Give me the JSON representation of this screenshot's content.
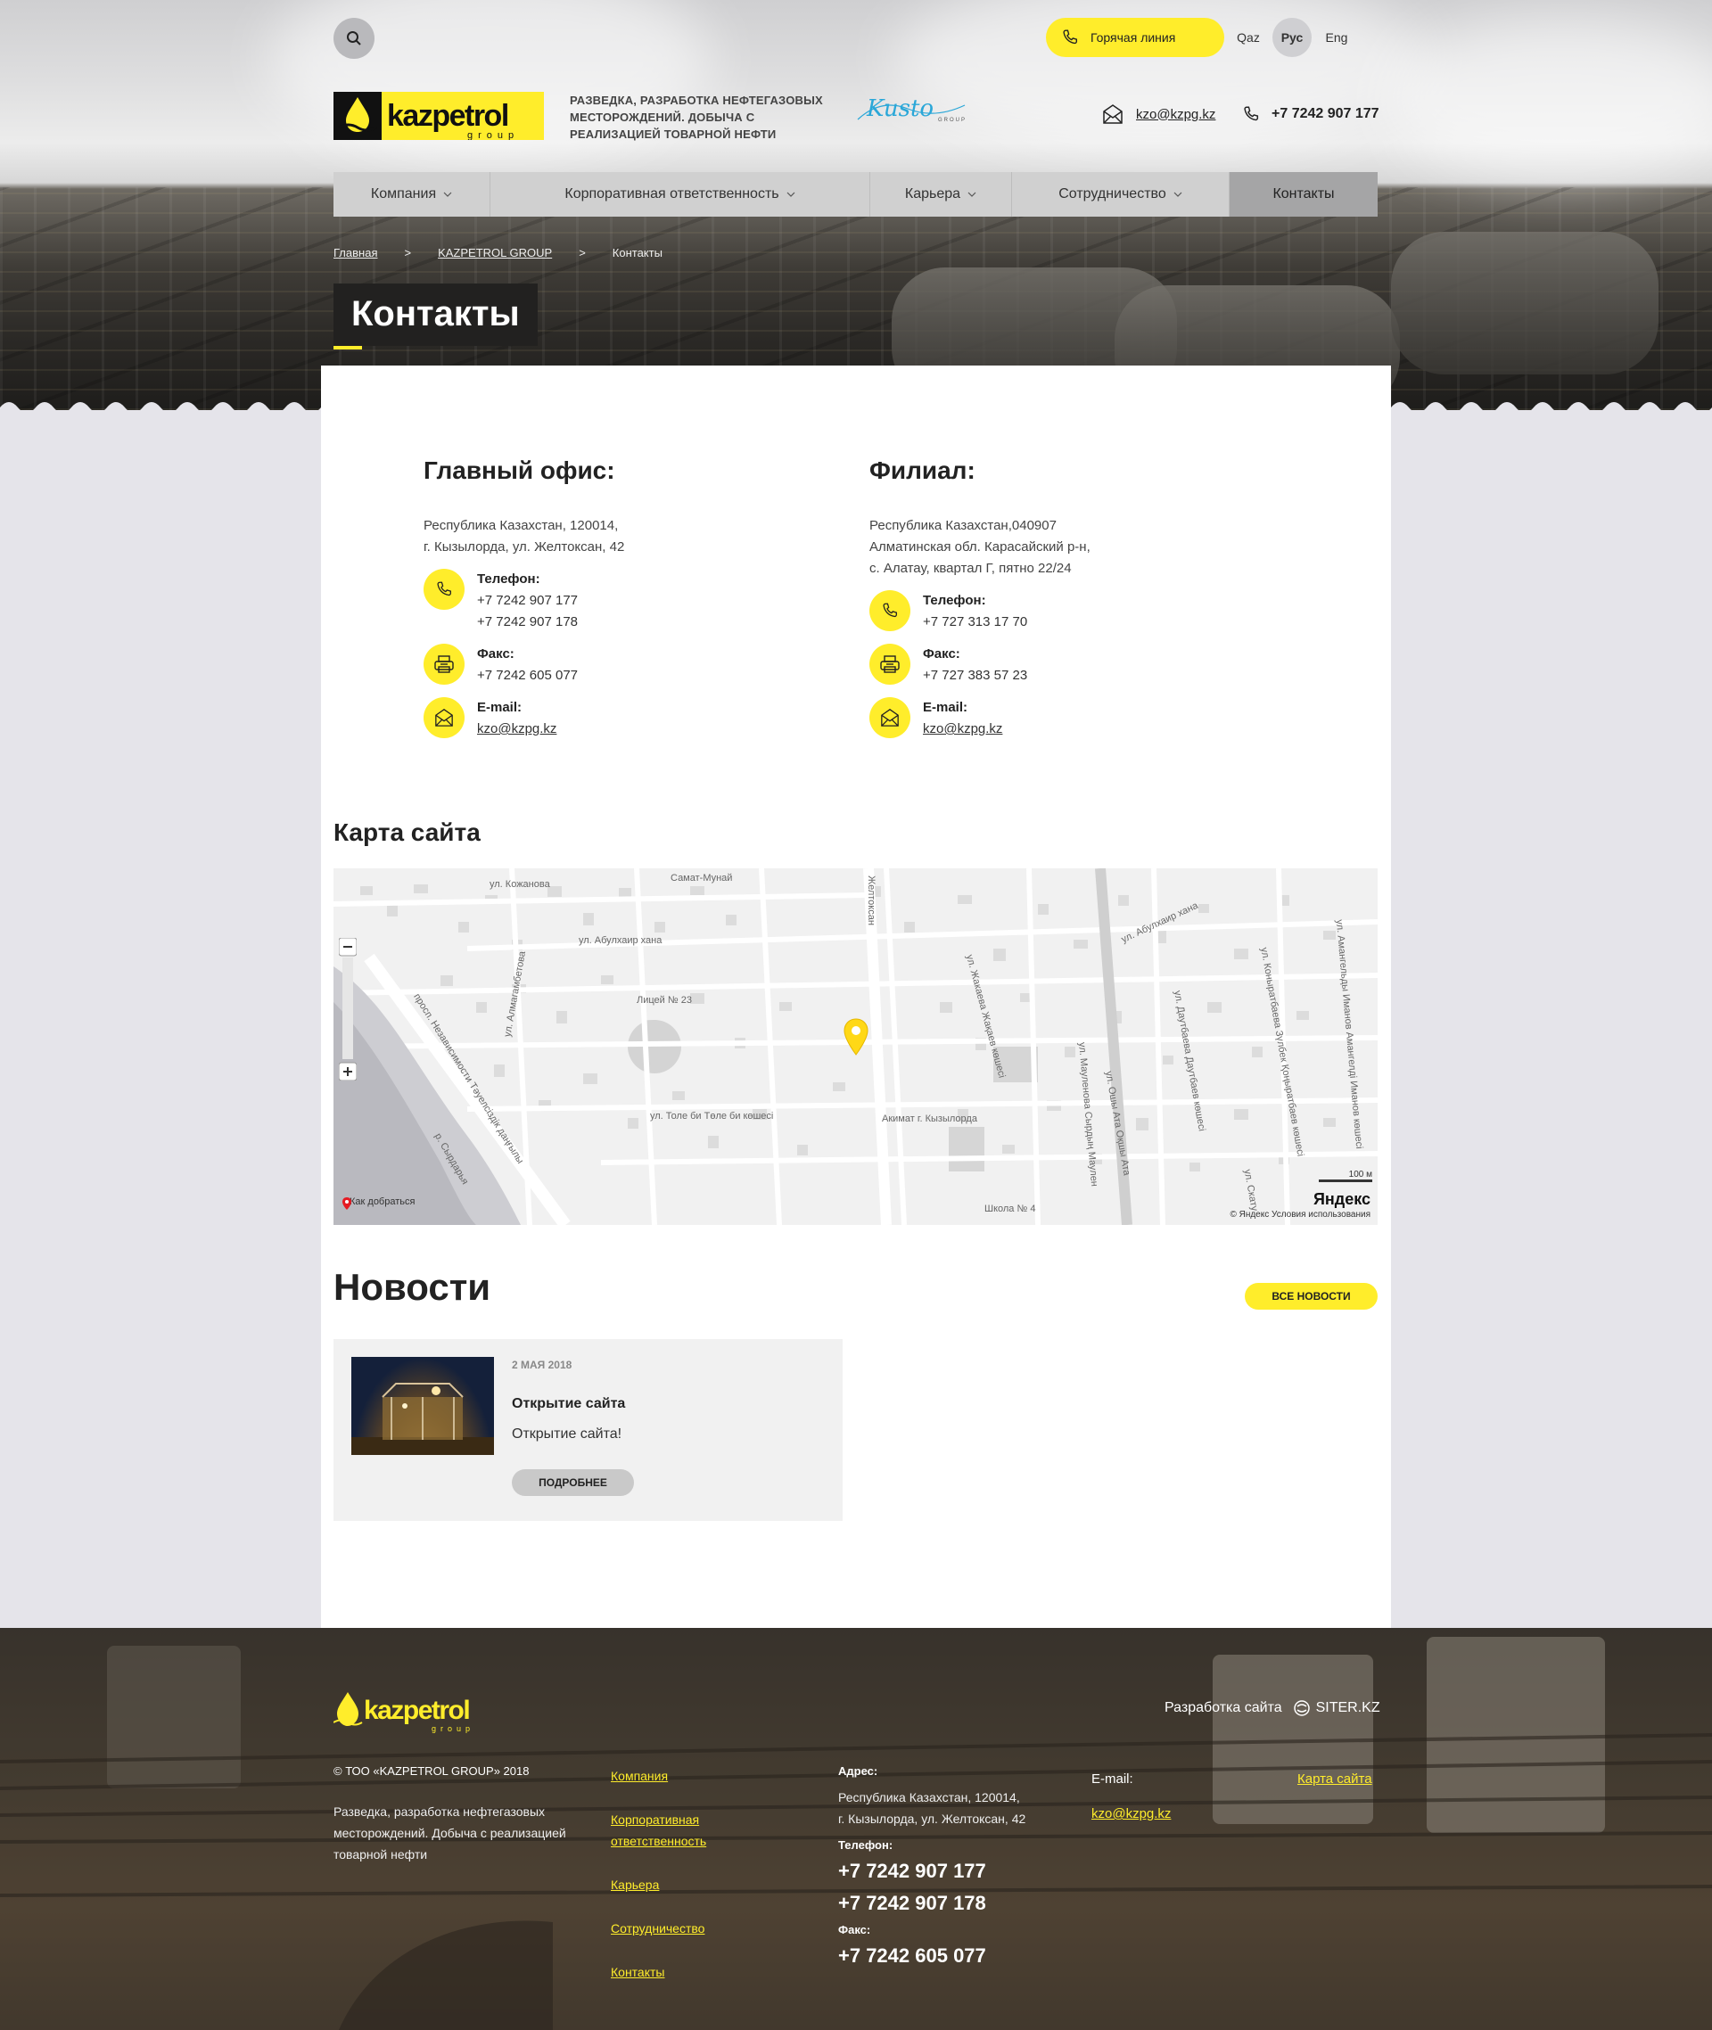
{
  "header": {
    "hotline_label": "Горячая линия",
    "languages": [
      {
        "label": "Qaz",
        "active": false
      },
      {
        "label": "Рус",
        "active": true
      },
      {
        "label": "Eng",
        "active": false
      }
    ],
    "logo_text": "kazpetrol",
    "logo_sub": "group",
    "tagline": "РАЗВЕДКА, РАЗРАБОТКА НЕФТЕГАЗОВЫХ МЕСТОРОЖДЕНИЙ. ДОБЫЧА С РЕАЛИЗАЦИЕЙ ТОВАРНОЙ НЕФТИ",
    "partner_logo_text": "Kusto",
    "partner_logo_sub": "GROUP",
    "email": "kzo@kzpg.kz",
    "phone": "+7 7242 907 177"
  },
  "nav": [
    {
      "label": "Компания",
      "dropdown": true
    },
    {
      "label": "Корпоративная ответственность",
      "dropdown": true
    },
    {
      "label": "Карьера",
      "dropdown": true
    },
    {
      "label": "Сотрудничество",
      "dropdown": true
    },
    {
      "label": "Контакты",
      "dropdown": false,
      "active": true
    }
  ],
  "breadcrumbs": {
    "home": "Главная",
    "group": "KAZPETROL GROUP",
    "current": "Контакты",
    "separator": ">"
  },
  "page_title": "Контакты",
  "main_office": {
    "title": "Главный офис:",
    "address_line1": "Республика Казахстан, 120014,",
    "address_line2": "г. Кызылорда, ул. Желтоксан, 42",
    "phone_label": "Телефон:",
    "phone1": "+7 7242 907 177",
    "phone2": "+7 7242 907 178",
    "fax_label": "Факс:",
    "fax": "+7 7242 605 077",
    "email_label": "E-mail:",
    "email": "kzo@kzpg.kz"
  },
  "branch": {
    "title": "Филиал:",
    "address_line1": "Республика Казахстан,040907",
    "address_line2": "Алматинская обл. Карасайский р-н,",
    "address_line3": "с. Алатау, квартал Г, пятно 22/24",
    "phone_label": "Телефон:",
    "phone1": "+7 727 313 17 70",
    "fax_label": "Факс:",
    "fax": "+7 727 383 57 23",
    "email_label": "E-mail:",
    "email": "kzo@kzpg.kz"
  },
  "map": {
    "title": "Карта сайта",
    "labels": {
      "street1": "ул. Кожанова",
      "street2": "ул. Абулхаир хана",
      "street3": "ул. Абулхаир хана",
      "street4": "Самат-Мунай",
      "street5": "Желтоксан",
      "street6": "Лицей № 23",
      "street7": "ул. Алмагамбетова",
      "street8": "просп. Независимости Тәуелсіздік даңғылы",
      "street9": "р. Сырдарья",
      "street10": "ул. Толе би Төле би көшесі",
      "street11": "Акимат г. Кызылорда",
      "street12": "ул. Жакаева Жақаев көшесі",
      "street13": "ул. Мауленова Сырдың Маулен",
      "street14": "ул. Ошы Ата Оқшы Ата",
      "street15": "ул. Даутбаева Даутбаев көшесі",
      "street16": "ул. Коныратбаева Зүлбек Қоңыратбаев көшесі",
      "street17": "ул. Амангельды Иманов Амангелді Иманов көшесі",
      "street18": "Школа № 4",
      "street19": "ул. Скату"
    },
    "route_label": "Как добраться",
    "scale_label": "100 м",
    "brand": "Яндекс",
    "copyright": "© Яндекс Условия использования"
  },
  "news": {
    "title": "Новости",
    "all_label": "ВСЕ НОВОСТИ",
    "items": [
      {
        "date": "2 МАЯ 2018",
        "title": "Открытие сайта",
        "text": "Открытие сайта!",
        "more_label": "ПОДРОБНЕЕ"
      }
    ]
  },
  "footer": {
    "developer_label": "Разработка сайта",
    "developer_name": "SITER.KZ",
    "copyright": "© ТОО «KAZPETROL GROUP» 2018",
    "description": "Разведка, разработка нефтегазовых месторождений. Добыча с реализацией товарной нефти",
    "menu": [
      "Компания",
      "Корпоративная ответственность",
      "Карьера",
      "Сотрудничество",
      "Контакты"
    ],
    "address_label": "Адрес:",
    "address_line1": "Республика Казахстан, 120014,",
    "address_line2": "г. Кызылорда, ул. Желтоксан, 42",
    "phone_label": "Телефон:",
    "phone1": "+7 7242 907 177",
    "phone2": "+7 7242 907 178",
    "fax_label": "Факс:",
    "fax": "+7 7242 605 077",
    "email_label": "E-mail:",
    "email": "kzo@kzpg.kz",
    "sitemap_label": "Карта сайта"
  },
  "colors": {
    "accent": "#ffed2b",
    "nav_bg": "#d0d0d0",
    "nav_active": "#a5a5a6",
    "page_bg": "#e5e4ea",
    "footer_link": "#ffed2b"
  },
  "icons": {
    "search": "search-icon",
    "phone": "phone-icon",
    "fax": "fax-icon",
    "email": "envelope-icon",
    "chevron": "chevron-down-icon",
    "map_pin": "map-pin-icon"
  }
}
